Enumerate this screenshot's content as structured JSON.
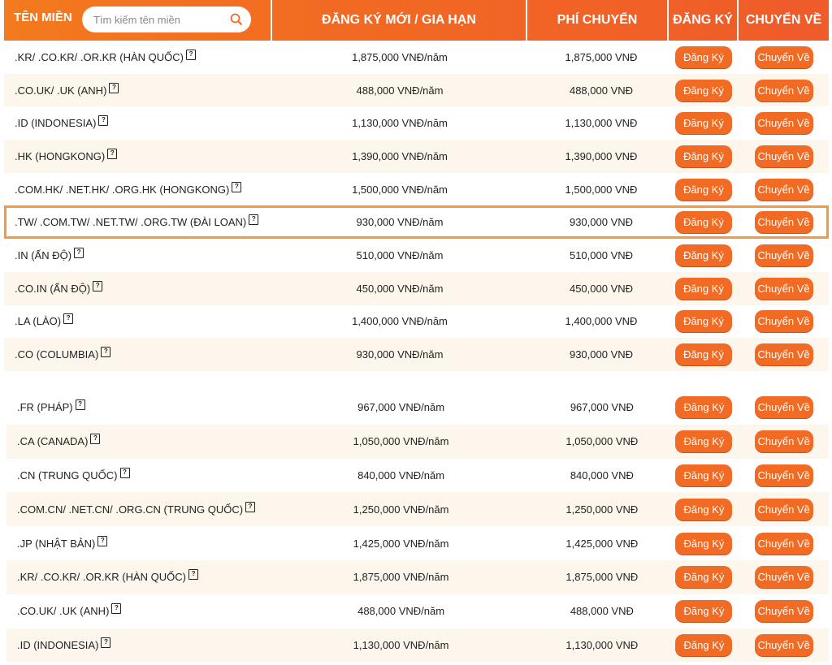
{
  "header": {
    "col_domain": "TÊN MIỀN",
    "search_placeholder": "Tìm kiếm tên miền",
    "col_price": "ĐĂNG KÝ MỚI / GIA HẠN",
    "col_transfer_fee": "PHÍ CHUYỂN",
    "col_register": "ĐĂNG KÝ",
    "col_transfer": "CHUYỂN VỀ"
  },
  "buttons": {
    "register": "Đăng Ký",
    "transfer": "Chuyển Về"
  },
  "colors": {
    "accent": "#f26b24",
    "row_alt": "#fdf6ec",
    "selected_outline": "#f29a3d"
  },
  "rows_top": [
    {
      "domain": ".KR/ .CO.KR/ .OR.KR (HÀN QUỐC)",
      "price": "1,875,000 VNĐ/năm",
      "fee": "1,875,000 VNĐ"
    },
    {
      "domain": ".CO.UK/ .UK (ANH)",
      "price": "488,000 VNĐ/năm",
      "fee": "488,000 VNĐ"
    },
    {
      "domain": ".ID (INDONESIA)",
      "price": "1,130,000 VNĐ/năm",
      "fee": "1,130,000 VNĐ"
    },
    {
      "domain": ".HK (HONGKONG)",
      "price": "1,390,000 VNĐ/năm",
      "fee": "1,390,000 VNĐ"
    },
    {
      "domain": ".COM.HK/ .NET.HK/ .ORG.HK (HONGKONG)",
      "price": "1,500,000 VNĐ/năm",
      "fee": "1,500,000 VNĐ"
    },
    {
      "domain": ".TW/ .COM.TW/ .NET.TW/ .ORG.TW (ĐÀI LOAN)",
      "price": "930,000 VNĐ/năm",
      "fee": "930,000 VNĐ"
    },
    {
      "domain": ".IN (ẤN ĐỘ)",
      "price": "510,000 VNĐ/năm",
      "fee": "510,000 VNĐ"
    },
    {
      "domain": ".CO.IN (ẤN ĐỘ)",
      "price": "450,000 VNĐ/năm",
      "fee": "450,000 VNĐ"
    },
    {
      "domain": ".LA (LÀO)",
      "price": "1,400,000 VNĐ/năm",
      "fee": "1,400,000 VNĐ"
    },
    {
      "domain": ".CO (COLUMBIA)",
      "price": "930,000 VNĐ/năm",
      "fee": "930,000 VNĐ"
    }
  ],
  "rows_bottom": [
    {
      "domain": ".FR (PHÁP)",
      "price": "967,000 VNĐ/năm",
      "fee": "967,000 VNĐ"
    },
    {
      "domain": ".CA (CANADA)",
      "price": "1,050,000 VNĐ/năm",
      "fee": "1,050,000 VNĐ"
    },
    {
      "domain": ".CN (TRUNG QUỐC)",
      "price": "840,000 VNĐ/năm",
      "fee": "840,000 VNĐ"
    },
    {
      "domain": ".COM.CN/ .NET.CN/ .ORG.CN (TRUNG QUỐC)",
      "price": "1,250,000 VNĐ/năm",
      "fee": "1,250,000 VNĐ"
    },
    {
      "domain": ".JP (NHẬT BẢN)",
      "price": "1,425,000 VNĐ/năm",
      "fee": "1,425,000 VNĐ"
    },
    {
      "domain": ".KR/ .CO.KR/ .OR.KR (HÀN QUỐC)",
      "price": "1,875,000 VNĐ/năm",
      "fee": "1,875,000 VNĐ"
    },
    {
      "domain": ".CO.UK/ .UK (ANH)",
      "price": "488,000 VNĐ/năm",
      "fee": "488,000 VNĐ"
    },
    {
      "domain": ".ID (INDONESIA)",
      "price": "1,130,000 VNĐ/năm",
      "fee": "1,130,000 VNĐ"
    }
  ]
}
